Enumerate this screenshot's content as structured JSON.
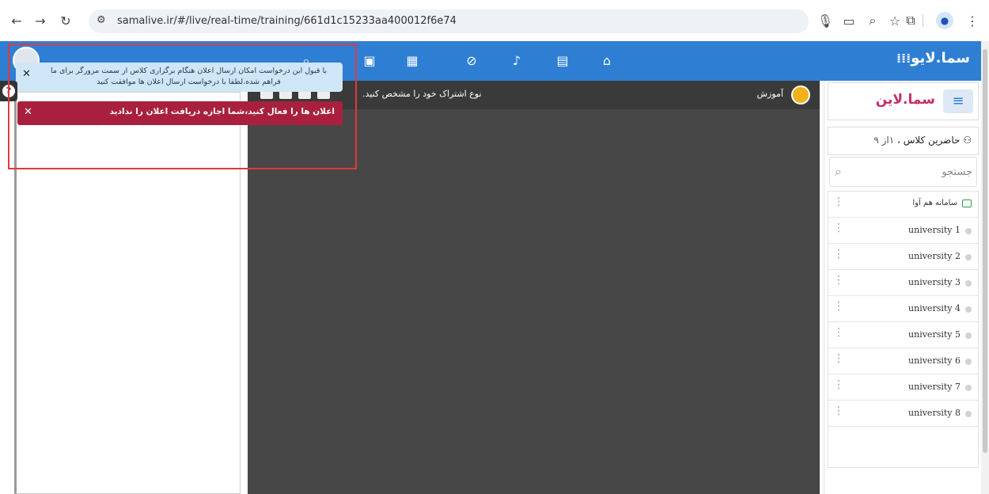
{
  "browser": {
    "url": "samalive.ir/#/live/real-time/training/661d1c15233aa400012f6e74"
  },
  "app": {
    "brand": "سما.لایو",
    "logo_text": "سما.لاین"
  },
  "sidebar": {
    "attendees_label": "حاضرین کلاس",
    "attendees_count": "۱از ۹",
    "search_placeholder": "جستجو",
    "system_row": "سامانه هم آوا",
    "attendees": [
      "university 1",
      "university 2",
      "university 3",
      "university 4",
      "university 5",
      "university 6",
      "university 7",
      "university 8"
    ]
  },
  "main": {
    "education_label": "آموزش",
    "share_type_label": "نوع اشتراک خود را مشخص کنید."
  },
  "notifications": {
    "info_text": "با قبول این درخواست امکان ارسال اعلان هنگام برگزاری کلاس از سمت مرورگر برای ما فراهم شده.لطفا با درخواست ارسال اعلان ها موافقت کنید",
    "error_text": "اعلان ها را فعال کنید،شما اجازه دریافت اعلان را ندادید"
  },
  "colors": {
    "topbar": "#2e7fd3",
    "error": "#a9203e",
    "info": "#cfe6f6",
    "highlight": "#e03a3a"
  }
}
